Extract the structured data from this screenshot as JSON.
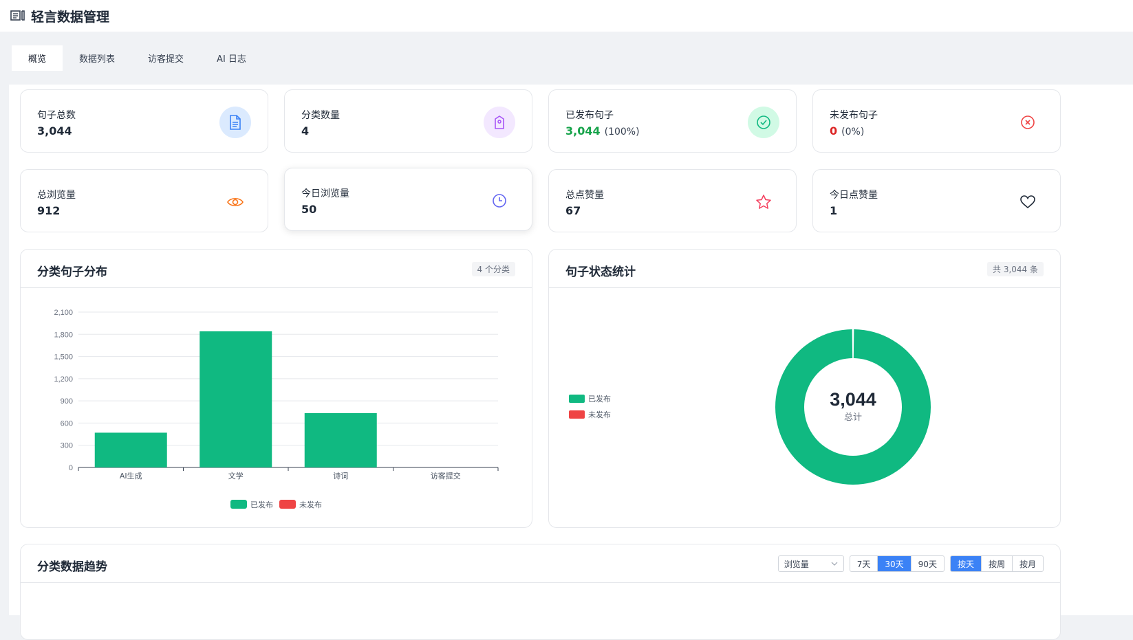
{
  "header": {
    "title": "轻言数据管理",
    "icon": "dashboard-icon"
  },
  "tabs": [
    {
      "label": "概览",
      "active": true
    },
    {
      "label": "数据列表",
      "active": false
    },
    {
      "label": "访客提交",
      "active": false
    },
    {
      "label": "AI 日志",
      "active": false
    }
  ],
  "stats": {
    "total_sentences": {
      "label": "句子总数",
      "value": "3,044",
      "icon": "document-icon"
    },
    "category_count": {
      "label": "分类数量",
      "value": "4",
      "icon": "tag-icon"
    },
    "published": {
      "label": "已发布句子",
      "value": "3,044",
      "pct": "(100%)",
      "icon": "check-circle-icon"
    },
    "unpublished": {
      "label": "未发布句子",
      "value": "0",
      "pct": "(0%)",
      "icon": "x-circle-icon"
    },
    "total_views": {
      "label": "总浏览量",
      "value": "912",
      "icon": "eye-icon"
    },
    "today_views": {
      "label": "今日浏览量",
      "value": "50",
      "icon": "clock-icon"
    },
    "total_likes": {
      "label": "总点赞量",
      "value": "67",
      "icon": "star-icon"
    },
    "today_likes": {
      "label": "今日点赞量",
      "value": "1",
      "icon": "heart-icon"
    }
  },
  "category_panel": {
    "title": "分类句子分布",
    "badge": "4 个分类"
  },
  "status_panel": {
    "title": "句子状态统计",
    "badge": "共 3,044 条",
    "center_value": "3,044",
    "center_label": "总计"
  },
  "trend_panel": {
    "title": "分类数据趋势",
    "metric_select": "浏览量",
    "range_buttons": [
      {
        "label": "7天",
        "active": false
      },
      {
        "label": "30天",
        "active": true
      },
      {
        "label": "90天",
        "active": false
      }
    ],
    "granularity_buttons": [
      {
        "label": "按天",
        "active": true
      },
      {
        "label": "按周",
        "active": false
      },
      {
        "label": "按月",
        "active": false
      }
    ]
  },
  "colors": {
    "published": "#10b981",
    "unpublished": "#ef4444",
    "accent": "#3b82f6"
  },
  "chart_data": [
    {
      "type": "bar",
      "categories": [
        "AI生成",
        "文学",
        "诗词",
        "访客提交"
      ],
      "series": [
        {
          "name": "已发布",
          "values": [
            470,
            1840,
            735,
            0
          ]
        },
        {
          "name": "未发布",
          "values": [
            0,
            0,
            0,
            0
          ]
        }
      ],
      "ylim": [
        0,
        2100
      ],
      "yticks": [
        "0",
        "300",
        "600",
        "900",
        "1,200",
        "1,500",
        "1,800",
        "2,100"
      ],
      "legend": "bottom",
      "grid": true
    },
    {
      "type": "pie",
      "categories": [
        "已发布",
        "未发布"
      ],
      "values": [
        3044,
        0
      ],
      "legend": "left"
    }
  ]
}
